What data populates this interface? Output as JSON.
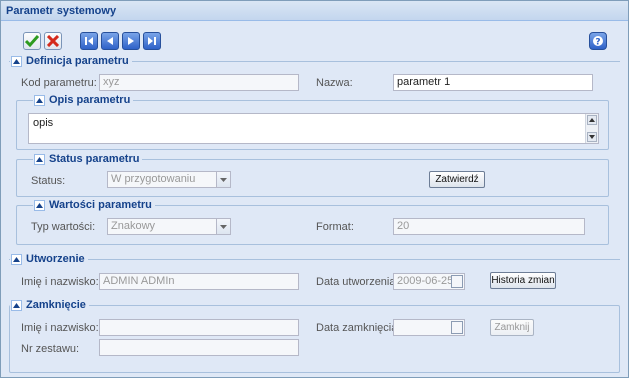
{
  "window": {
    "title": "Parametr systemowy"
  },
  "toolbar": {
    "icons": [
      "check-icon",
      "cancel-icon",
      "first-icon",
      "prev-icon",
      "next-icon",
      "last-icon",
      "help-icon"
    ]
  },
  "definicja": {
    "title": "Definicja parametru",
    "kod_label": "Kod parametru:",
    "kod_value": "xyz",
    "nazwa_label": "Nazwa:",
    "nazwa_value": "parametr 1"
  },
  "opis": {
    "title": "Opis parametru",
    "value": "opis"
  },
  "status": {
    "title": "Status parametru",
    "status_label": "Status:",
    "status_value": "W przygotowaniu",
    "zatwierdz_label": "Zatwierdź"
  },
  "wartosci": {
    "title": "Wartości parametru",
    "typ_label": "Typ wartości:",
    "typ_value": "Znakowy",
    "format_label": "Format:",
    "format_value": "20"
  },
  "utworzenie": {
    "title": "Utworzenie",
    "imie_label": "Imię i nazwisko:",
    "imie_value": "ADMIN ADMIn",
    "data_label": "Data utworzenia:",
    "data_value": "2009-06-25",
    "historia_label": "Historia zmian"
  },
  "zamkniecie": {
    "title": "Zamknięcie",
    "imie_label": "Imię i nazwisko:",
    "imie_value": "",
    "data_label": "Data zamknięcia:",
    "data_value": "",
    "zamknij_label": "Zamknij",
    "nr_label": "Nr zestawu:",
    "nr_value": ""
  }
}
